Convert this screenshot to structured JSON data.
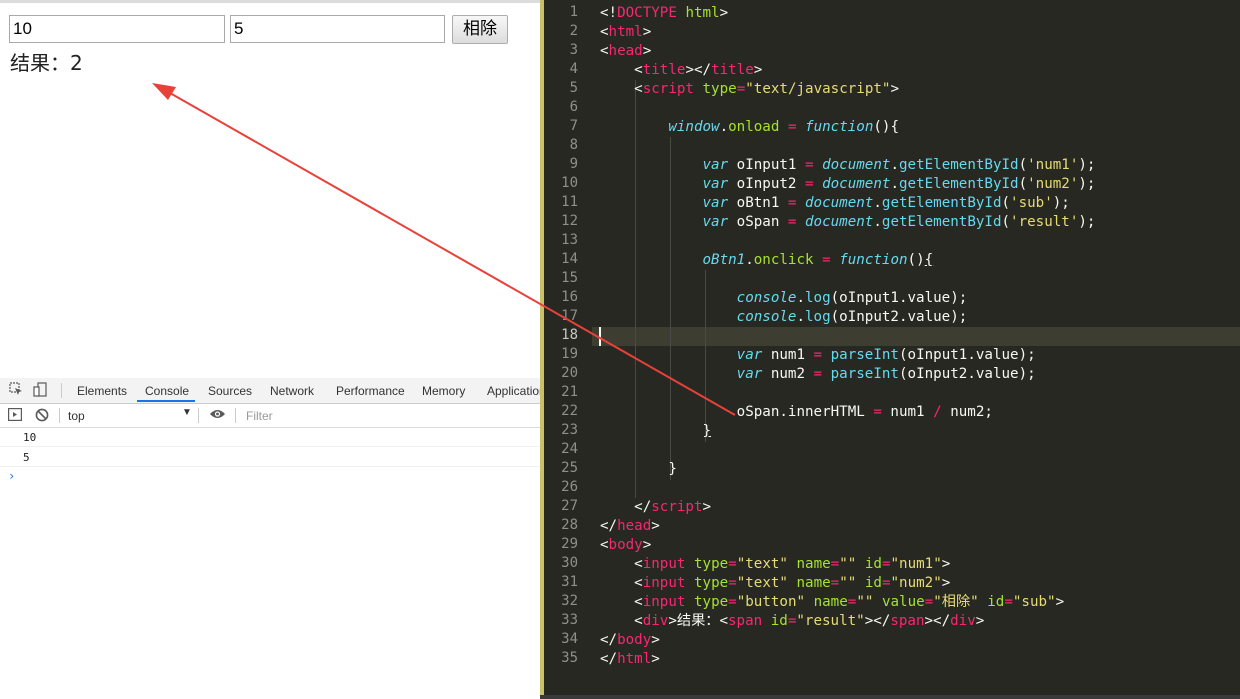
{
  "browser": {
    "input1_value": "10",
    "input2_value": "5",
    "button_label": "相除",
    "result_label": "结果：",
    "result_value": "2"
  },
  "devtools": {
    "tabs": [
      "Elements",
      "Console",
      "Sources",
      "Network",
      "Performance",
      "Memory",
      "Application"
    ],
    "active_tab": "Console",
    "context": "top",
    "filter_placeholder": "Filter",
    "logs": [
      "10",
      "5"
    ],
    "prompt": "›",
    "accent": "#1a73e8"
  },
  "editor": {
    "line_numbers": [
      "1",
      "2",
      "3",
      "4",
      "5",
      "6",
      "7",
      "8",
      "9",
      "10",
      "11",
      "12",
      "13",
      "14",
      "15",
      "16",
      "17",
      "18",
      "19",
      "20",
      "21",
      "22",
      "23",
      "24",
      "25",
      "26",
      "27",
      "28",
      "29",
      "30",
      "31",
      "32",
      "33",
      "34",
      "35"
    ],
    "current_line": "18",
    "theme": {
      "bg": "#272822",
      "tag": "#f92672",
      "attr": "#a6e22e",
      "string": "#e6db74",
      "keyword": "#66d9ef"
    }
  },
  "annotation": {
    "arrow_color": "#e8413a"
  }
}
